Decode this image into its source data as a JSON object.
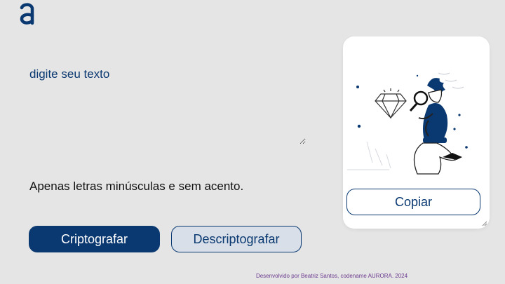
{
  "brand": {
    "logo_icon": "alura-logo-icon",
    "color": "#0a3871"
  },
  "editor": {
    "placeholder": "digite seu texto"
  },
  "note": {
    "text": "Apenas letras minúsculas e sem acento."
  },
  "actions": {
    "encrypt_label": "Criptografar",
    "decrypt_label": "Descriptografar"
  },
  "output_panel": {
    "illustration_icon": "person-with-magnifier-illustration",
    "copy_label": "Copiar"
  },
  "footer": {
    "text": "Desenvolvido por Beatriz Santos, codename AURORA. 2024"
  },
  "colors": {
    "accent": "#0a3871",
    "background": "#e5e5e5",
    "secondary_button": "#d8dfe8",
    "footer": "#6b3a8e"
  }
}
